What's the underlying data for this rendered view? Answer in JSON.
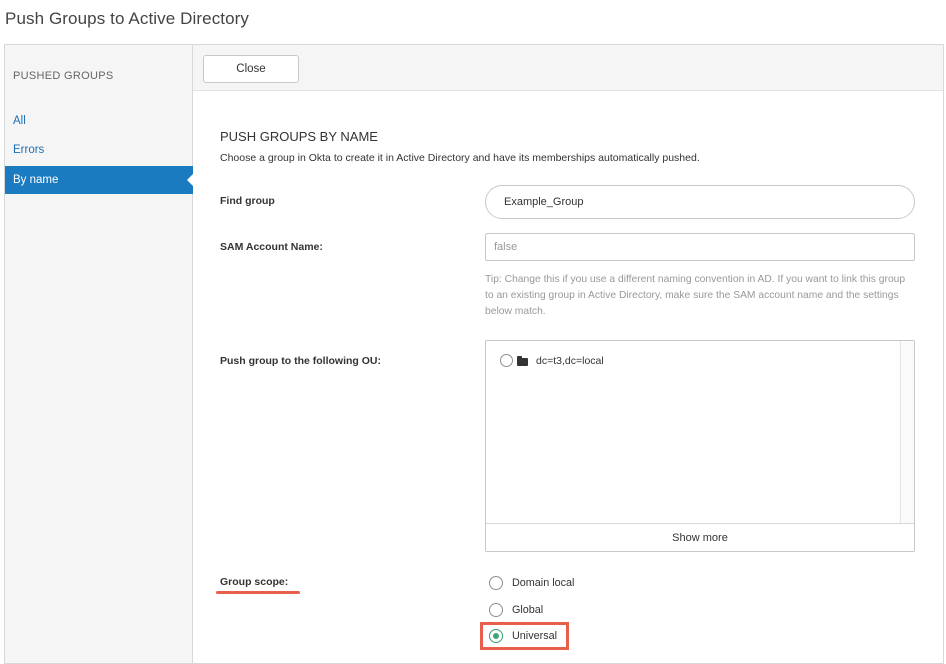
{
  "page_title": "Push Groups to Active Directory",
  "sidebar": {
    "heading": "PUSHED GROUPS",
    "items": [
      {
        "label": "All",
        "active": false
      },
      {
        "label": "Errors",
        "active": false
      },
      {
        "label": "By name",
        "active": true
      }
    ]
  },
  "toolbar": {
    "close_label": "Close"
  },
  "main": {
    "section_title": "PUSH GROUPS BY NAME",
    "section_desc": "Choose a group in Okta to create it in Active Directory and have its memberships automatically pushed.",
    "find_group": {
      "label": "Find group",
      "value": "Example_Group"
    },
    "sam_account": {
      "label": "SAM Account Name:",
      "value": "false",
      "tip": "Tip: Change this if you use a different naming convention in AD. If you want to link this group to an existing group in Active Directory, make sure the SAM account name and the settings below match."
    },
    "ou": {
      "label": "Push group to the following OU:",
      "items": [
        {
          "label": "dc=t3,dc=local",
          "icon": "folder-icon",
          "selected": false
        }
      ],
      "show_more_label": "Show more"
    },
    "group_scope": {
      "label": "Group scope:",
      "options": [
        {
          "label": "Domain local",
          "selected": false
        },
        {
          "label": "Global",
          "selected": false
        },
        {
          "label": "Universal",
          "selected": true
        }
      ]
    }
  },
  "colors": {
    "accent_blue": "#1b7bc0",
    "link_blue": "#1a6fb5",
    "highlight_red": "#e8604c",
    "radio_green": "#3aa874"
  }
}
